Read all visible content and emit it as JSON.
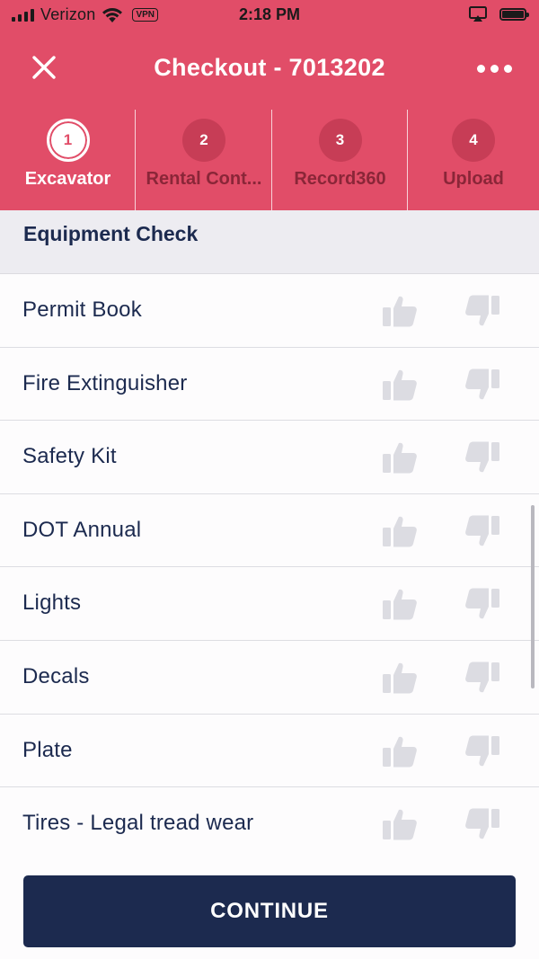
{
  "status_bar": {
    "carrier": "Verizon",
    "vpn": "VPN",
    "time": "2:18 PM"
  },
  "nav": {
    "title": "Checkout - 7013202"
  },
  "steps": [
    {
      "number": "1",
      "label": "Excavator",
      "active": true
    },
    {
      "number": "2",
      "label": "Rental Cont...",
      "active": false
    },
    {
      "number": "3",
      "label": "Record360",
      "active": false
    },
    {
      "number": "4",
      "label": "Upload",
      "active": false
    }
  ],
  "section": {
    "title": "Equipment Check"
  },
  "checklist": [
    {
      "label": "Permit Book"
    },
    {
      "label": "Fire Extinguisher"
    },
    {
      "label": "Safety Kit"
    },
    {
      "label": "DOT Annual"
    },
    {
      "label": "Lights"
    },
    {
      "label": "Decals"
    },
    {
      "label": "Plate"
    },
    {
      "label": "Tires - Legal tread wear"
    }
  ],
  "footer": {
    "continue_label": "CONTINUE"
  },
  "colors": {
    "header": "#e14d68",
    "navy": "#1c2a4f",
    "thumb": "#dcdce2"
  }
}
